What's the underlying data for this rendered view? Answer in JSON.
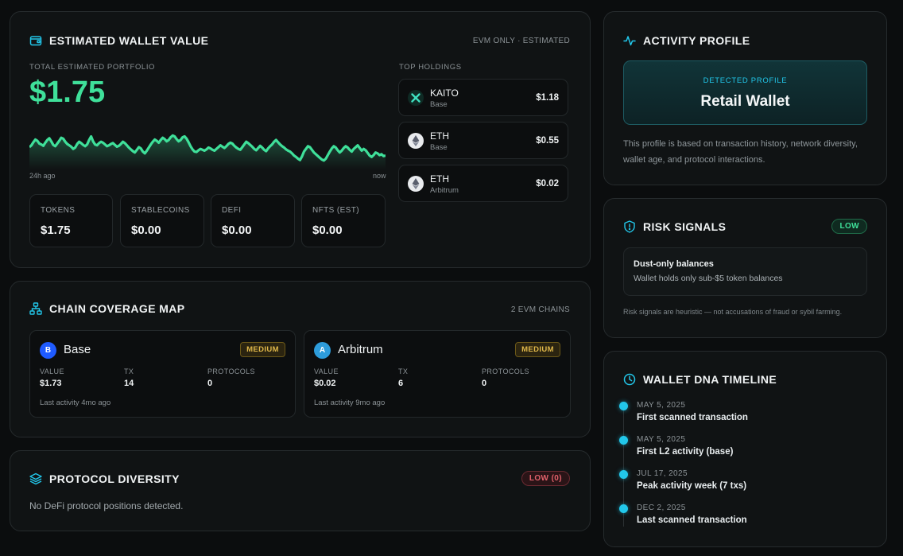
{
  "wallet_value": {
    "title": "ESTIMATED WALLET VALUE",
    "scope": "EVM ONLY · ESTIMATED",
    "portfolio_label": "TOTAL ESTIMATED PORTFOLIO",
    "portfolio_value": "$1.75",
    "chart_start_label": "24h ago",
    "chart_end_label": "now",
    "sparkline": [
      0.34,
      0.38,
      0.45,
      0.51,
      0.48,
      0.42,
      0.4,
      0.37,
      0.44,
      0.5,
      0.54,
      0.47,
      0.39,
      0.36,
      0.42,
      0.48,
      0.55,
      0.53,
      0.46,
      0.41,
      0.38,
      0.35,
      0.3,
      0.33,
      0.41,
      0.46,
      0.43,
      0.39,
      0.36,
      0.4,
      0.5,
      0.58,
      0.47,
      0.4,
      0.38,
      0.43,
      0.46,
      0.44,
      0.4,
      0.36,
      0.38,
      0.41,
      0.43,
      0.39,
      0.35,
      0.37,
      0.41,
      0.46,
      0.43,
      0.38,
      0.33,
      0.29,
      0.25,
      0.22,
      0.28,
      0.34,
      0.31,
      0.24,
      0.2,
      0.26,
      0.33,
      0.4,
      0.46,
      0.51,
      0.48,
      0.44,
      0.5,
      0.55,
      0.52,
      0.47,
      0.5,
      0.56,
      0.6,
      0.58,
      0.52,
      0.47,
      0.5,
      0.56,
      0.58,
      0.53,
      0.45,
      0.36,
      0.29,
      0.24,
      0.23,
      0.27,
      0.3,
      0.28,
      0.26,
      0.29,
      0.33,
      0.31,
      0.28,
      0.26,
      0.3,
      0.34,
      0.38,
      0.35,
      0.32,
      0.36,
      0.41,
      0.44,
      0.42,
      0.37,
      0.33,
      0.3,
      0.28,
      0.34,
      0.4,
      0.46,
      0.43,
      0.39,
      0.35,
      0.3,
      0.27,
      0.32,
      0.37,
      0.33,
      0.28,
      0.25,
      0.31,
      0.36,
      0.4,
      0.46,
      0.5,
      0.45,
      0.4,
      0.36,
      0.33,
      0.29,
      0.26,
      0.24,
      0.2,
      0.15,
      0.12,
      0.08,
      0.05,
      0.13,
      0.24,
      0.3,
      0.36,
      0.34,
      0.28,
      0.22,
      0.18,
      0.14,
      0.1,
      0.06,
      0.04,
      0.08,
      0.16,
      0.24,
      0.31,
      0.36,
      0.33,
      0.27,
      0.22,
      0.26,
      0.32,
      0.36,
      0.33,
      0.28,
      0.24,
      0.3,
      0.34,
      0.38,
      0.32,
      0.26,
      0.3,
      0.27,
      0.21,
      0.15,
      0.12,
      0.16,
      0.22,
      0.2,
      0.16,
      0.18,
      0.14,
      0.15
    ],
    "holdings_label": "TOP HOLDINGS",
    "holdings": [
      {
        "symbol": "KAITO",
        "chain": "Base",
        "value": "$1.18",
        "icon": "kaito-icon"
      },
      {
        "symbol": "ETH",
        "chain": "Base",
        "value": "$0.55",
        "icon": "ethereum-icon"
      },
      {
        "symbol": "ETH",
        "chain": "Arbitrum",
        "value": "$0.02",
        "icon": "ethereum-icon"
      }
    ],
    "stats": [
      {
        "label": "TOKENS",
        "value": "$1.75"
      },
      {
        "label": "STABLECOINS",
        "value": "$0.00"
      },
      {
        "label": "DEFI",
        "value": "$0.00"
      },
      {
        "label": "NFTS (EST)",
        "value": "$0.00"
      }
    ]
  },
  "chain_coverage": {
    "title": "CHAIN COVERAGE MAP",
    "count": "2 EVM CHAINS",
    "col_labels": {
      "value": "VALUE",
      "tx": "TX",
      "protocols": "PROTOCOLS"
    },
    "chains": [
      {
        "letter": "B",
        "name": "Base",
        "badge": "MEDIUM",
        "value": "$1.73",
        "tx": "14",
        "protocols": "0",
        "last_activity": "Last activity 4mo ago",
        "color": "#1f5bff"
      },
      {
        "letter": "A",
        "name": "Arbitrum",
        "badge": "MEDIUM",
        "value": "$0.02",
        "tx": "6",
        "protocols": "0",
        "last_activity": "Last activity 9mo ago",
        "color": "#2d9cdb"
      }
    ]
  },
  "protocol_diversity": {
    "title": "PROTOCOL DIVERSITY",
    "badge": "LOW (0)",
    "message": "No DeFi protocol positions detected."
  },
  "activity_profile": {
    "title": "ACTIVITY PROFILE",
    "detected_label": "DETECTED PROFILE",
    "profile": "Retail Wallet",
    "description": "This profile is based on transaction history, network diversity, wallet age, and protocol interactions."
  },
  "risk_signals": {
    "title": "RISK SIGNALS",
    "level": "LOW",
    "signal_title": "Dust-only balances",
    "signal_text": "Wallet holds only sub-$5 token balances",
    "disclaimer": "Risk signals are heuristic — not accusations of fraud or sybil farming."
  },
  "timeline": {
    "title": "WALLET DNA TIMELINE",
    "events": [
      {
        "date": "MAY 5, 2025",
        "event": "First scanned transaction"
      },
      {
        "date": "MAY 5, 2025",
        "event": "First L2 activity (base)"
      },
      {
        "date": "JUL 17, 2025",
        "event": "Peak activity week (7 txs)"
      },
      {
        "date": "DEC 2, 2025",
        "event": "Last scanned transaction"
      }
    ]
  },
  "colors": {
    "accent_green": "#3fe09a",
    "accent_cyan": "#22c7ea",
    "badge_medium": "#e0b84a",
    "badge_low_red": "#e0606a"
  }
}
